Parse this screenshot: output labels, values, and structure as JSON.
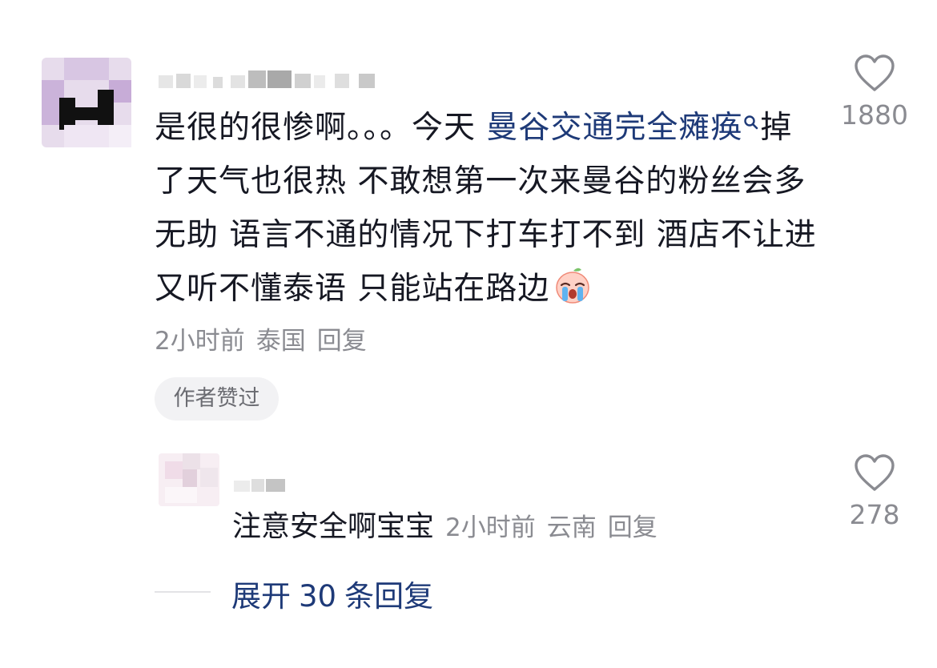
{
  "comment": {
    "text_parts": {
      "before_keyword": "是很的很惨啊。。。今天 ",
      "keyword": "曼谷交通完全瘫痪",
      "after_keyword": "掉了天气也很热 不敢想第一次来曼谷的粉丝会多无助 语言不通的情况下打车打不到 酒店不让进 又听不懂泰语 只能站在路边"
    },
    "emoji": "crying-face",
    "time": "2小时前",
    "location": "泰国",
    "reply_label": "回复",
    "badge": "作者赞过",
    "like_count": "1880",
    "like_icon": "heart-outline-icon"
  },
  "reply": {
    "text": "注意安全啊宝宝",
    "time": "2小时前",
    "location": "云南",
    "reply_label": "回复",
    "like_count": "278",
    "like_icon": "heart-outline-icon"
  },
  "expand": {
    "label": "展开",
    "count": "30",
    "suffix": "条回复"
  },
  "colors": {
    "text": "#161823",
    "meta": "#8a8b91",
    "link": "#1e3a78",
    "badge_bg": "#f2f2f4"
  }
}
